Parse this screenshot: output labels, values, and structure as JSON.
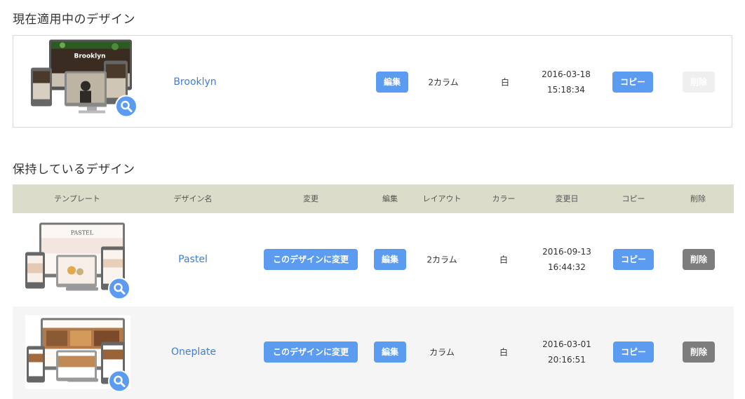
{
  "current": {
    "section_title": "現在適用中のデザイン",
    "row": {
      "thumb_text": "Brooklyn",
      "name": "Brooklyn",
      "edit": "編集",
      "layout": "2カラム",
      "color": "白",
      "date": "2016-03-18",
      "time": "15:18:34",
      "copy": "コピー",
      "delete": "削除"
    }
  },
  "owned": {
    "section_title": "保持しているデザイン",
    "headers": {
      "template": "テンプレート",
      "design_name": "デザイン名",
      "change": "変更",
      "edit": "編集",
      "layout": "レイアウト",
      "color": "カラー",
      "modified": "変更日",
      "copy": "コピー",
      "delete": "削除"
    },
    "rows": [
      {
        "thumb_text": "PASTEL",
        "name": "Pastel",
        "change": "このデザインに変更",
        "edit": "編集",
        "layout": "2カラム",
        "color": "白",
        "date": "2016-09-13",
        "time": "16:44:32",
        "copy": "コピー",
        "delete": "削除"
      },
      {
        "name": "Oneplate",
        "change": "このデザインに変更",
        "edit": "編集",
        "layout": "カラム",
        "color": "白",
        "date": "2016-03-01",
        "time": "20:16:51",
        "copy": "コピー",
        "delete": "削除"
      }
    ]
  },
  "colors": {
    "accent_blue": "#5b9bf0",
    "link_blue": "#3d7fd6",
    "header_bg": "#dcdcca",
    "delete_gray": "#7d7d7d"
  }
}
